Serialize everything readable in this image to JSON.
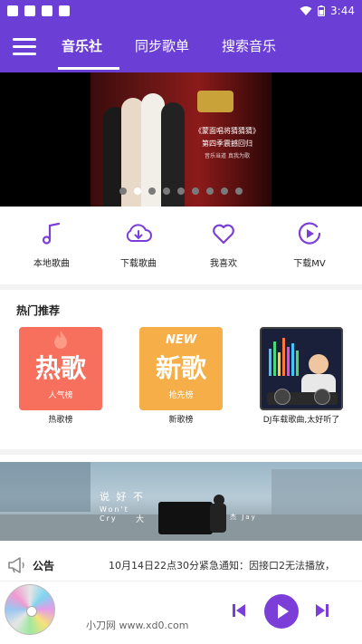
{
  "status_bar": {
    "time": "3:44"
  },
  "tabs": [
    {
      "label": "音乐社",
      "active": true
    },
    {
      "label": "同步歌单",
      "active": false
    },
    {
      "label": "搜索音乐",
      "active": false
    }
  ],
  "banner": {
    "dots_count": 9,
    "active_dot": 1,
    "text_lines": [
      "《蒙面唱将猜猜猜》",
      "第四季震撼回归",
      "音乐当道 真我为歌"
    ]
  },
  "quick_nav": [
    {
      "icon": "music-note-icon",
      "label": "本地歌曲"
    },
    {
      "icon": "cloud-download-icon",
      "label": "下载歌曲"
    },
    {
      "icon": "heart-icon",
      "label": "我喜欢"
    },
    {
      "icon": "play-circle-icon",
      "label": "下载MV"
    }
  ],
  "hot": {
    "title": "热门推荐",
    "cards": [
      {
        "cover_title": "热歌",
        "cover_sub": "人气榜",
        "label": "热歌榜",
        "color": "#f6705d"
      },
      {
        "cover_tag": "NEW",
        "cover_title": "新歌",
        "cover_sub": "抢先榜",
        "label": "新歌榜",
        "color": "#f6ae48"
      },
      {
        "label": "DJ车载歌曲,太好听了",
        "color": "#1a1f3a"
      }
    ]
  },
  "video_banner": {
    "line1": "说 好 不",
    "line2a": "Won't",
    "line2b": "Cry",
    "line3": "大",
    "line4": "杰 Jay"
  },
  "notice": {
    "label": "公告",
    "text": "10月14日22点30分紧急通知：因接口2无法播放，"
  },
  "player": {
    "watermark": "小刀网 www.xd0.com"
  },
  "colors": {
    "primary": "#6b3fd6",
    "play_button": "#7c3ed8"
  }
}
